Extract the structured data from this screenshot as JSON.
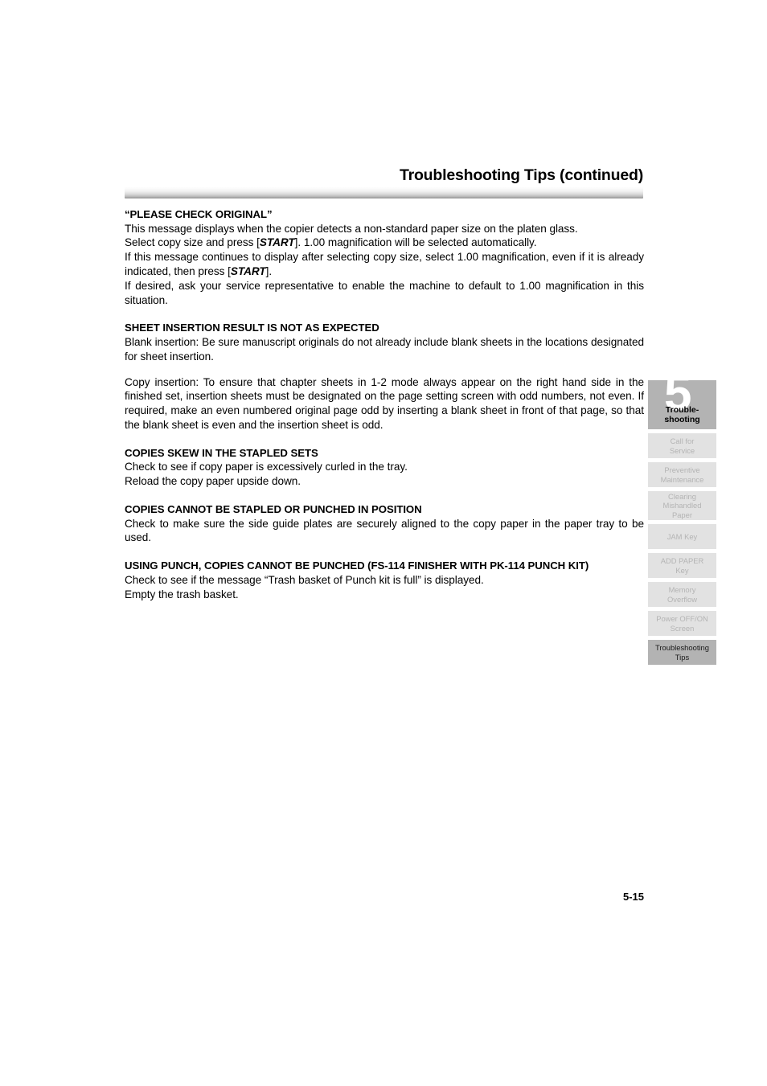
{
  "header": {
    "title": "Troubleshooting Tips (continued)"
  },
  "sections": [
    {
      "heading": "“PLEASE CHECK ORIGINAL”",
      "paragraphs": [
        "This message displays when the copier detects a non-standard paper size on the platen glass.",
        "Select copy size and press [START]. 1.00 magnification will be selected automatically.",
        "If this message continues to display after selecting copy size, select 1.00 magnification, even if it is already indicated, then press [START].",
        "If desired, ask your service representative to enable the machine to default to 1.00 magnification in this situation."
      ]
    },
    {
      "heading": "SHEET INSERTION RESULT IS NOT AS EXPECTED",
      "paragraphs": [
        "Blank insertion: Be sure manuscript originals do not already include blank sheets in the locations designated for sheet insertion.",
        "Copy insertion: To ensure that chapter sheets in 1-2 mode always appear on the right hand side in the finished set, insertion sheets must be designated on the page setting screen with odd numbers, not even. If required, make an even numbered original page odd by inserting a blank sheet in front of that page, so that the blank sheet is even and the insertion sheet is odd."
      ]
    },
    {
      "heading": "COPIES SKEW IN THE STAPLED SETS",
      "paragraphs": [
        "Check to see if copy paper is excessively curled in the tray.",
        "Reload the copy paper upside down."
      ]
    },
    {
      "heading": "COPIES CANNOT BE STAPLED OR PUNCHED IN POSITION",
      "paragraphs": [
        "Check to make sure the side guide plates are securely aligned to the copy paper in the paper tray to be used."
      ]
    },
    {
      "heading": "USING PUNCH, COPIES CANNOT BE PUNCHED (FS-114 FINISHER WITH PK-114 PUNCH KIT)",
      "paragraphs": [
        "Check to see if the message “Trash basket of Punch kit is full” is displayed.",
        "Empty the trash basket."
      ]
    }
  ],
  "sidebar": {
    "chapter": {
      "number": "5",
      "label": "Trouble-\nshooting"
    },
    "tabs": [
      {
        "label": "Call for\nService",
        "active": false
      },
      {
        "label": "Preventive\nMaintenance",
        "active": false
      },
      {
        "label": "Clearing\nMishandled\nPaper",
        "active": false
      },
      {
        "label": "JAM Key",
        "active": false
      },
      {
        "label": "ADD PAPER\nKey",
        "active": false
      },
      {
        "label": "Memory\nOverflow",
        "active": false
      },
      {
        "label": "Power OFF/ON\nScreen",
        "active": false
      },
      {
        "label": "Troubleshooting\nTips",
        "active": true
      }
    ]
  },
  "footer": {
    "page_number": "5-15"
  },
  "colors": {
    "active_tab_bg": "#b3b3b3",
    "inactive_tab_bg": "#e2e2e2",
    "inactive_tab_text": "#b4b4b4",
    "text": "#000000",
    "page_bg": "#ffffff"
  }
}
